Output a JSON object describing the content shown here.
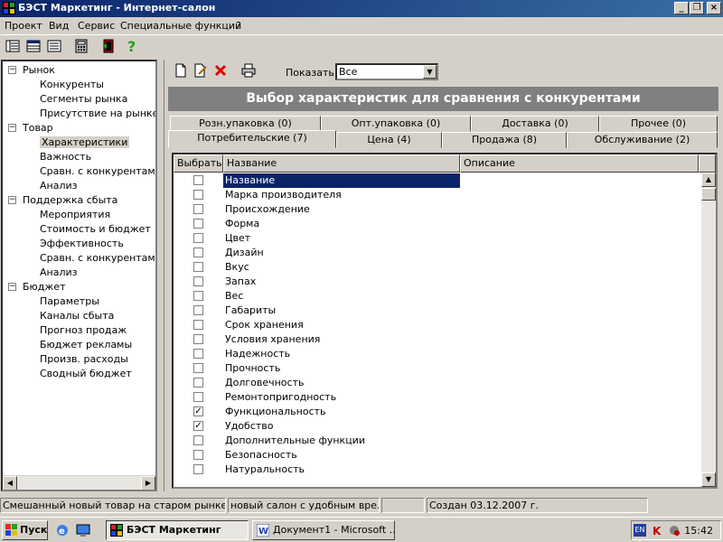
{
  "window": {
    "title": "БЭСТ Маркетинг - Интернет-салон"
  },
  "menu": [
    "Проект",
    "Вид",
    "Сервис",
    "Специальные функции",
    "?"
  ],
  "tree": [
    {
      "label": "Рынок",
      "level": 0,
      "toggle": "−"
    },
    {
      "label": "Конкуренты",
      "level": 1
    },
    {
      "label": "Сегменты рынка",
      "level": 1
    },
    {
      "label": "Присутствие на рынке",
      "level": 1
    },
    {
      "label": "Товар",
      "level": 0,
      "toggle": "−"
    },
    {
      "label": "Характеристики",
      "level": 1,
      "selected": true
    },
    {
      "label": "Важность",
      "level": 1
    },
    {
      "label": "Сравн. с конкурентами",
      "level": 1
    },
    {
      "label": "Анализ",
      "level": 1
    },
    {
      "label": "Поддержка сбыта",
      "level": 0,
      "toggle": "−"
    },
    {
      "label": "Мероприятия",
      "level": 1
    },
    {
      "label": "Стоимость и бюджет",
      "level": 1
    },
    {
      "label": "Эффективность",
      "level": 1
    },
    {
      "label": "Сравн. с конкурентами",
      "level": 1
    },
    {
      "label": "Анализ",
      "level": 1
    },
    {
      "label": "Бюджет",
      "level": 0,
      "toggle": "−"
    },
    {
      "label": "Параметры",
      "level": 1
    },
    {
      "label": "Каналы сбыта",
      "level": 1
    },
    {
      "label": "Прогноз продаж",
      "level": 1
    },
    {
      "label": "Бюджет рекламы",
      "level": 1
    },
    {
      "label": "Произв. расходы",
      "level": 1
    },
    {
      "label": "Сводный бюджет",
      "level": 1
    }
  ],
  "filter": {
    "label": "Показать",
    "value": "Все"
  },
  "banner": "Выбор характеристик для сравнения с конкурентами",
  "tabs_back": [
    "Розн.упаковка (0)",
    "Опт.упаковка (0)",
    "Доставка (0)",
    "Прочее (0)"
  ],
  "tabs_front": [
    "Потребительские (7)",
    "Цена (4)",
    "Продажа (8)",
    "Обслуживание (2)"
  ],
  "grid": {
    "headers": [
      "Выбрать",
      "Название",
      "Описание"
    ],
    "rows": [
      {
        "name": "Название",
        "checked": false,
        "selected": true
      },
      {
        "name": "Марка производителя",
        "checked": false
      },
      {
        "name": "Происхождение",
        "checked": false
      },
      {
        "name": "Форма",
        "checked": false
      },
      {
        "name": "Цвет",
        "checked": false
      },
      {
        "name": "Дизайн",
        "checked": false
      },
      {
        "name": "Вкус",
        "checked": false
      },
      {
        "name": "Запах",
        "checked": false
      },
      {
        "name": "Вес",
        "checked": false
      },
      {
        "name": "Габариты",
        "checked": false
      },
      {
        "name": "Срок хранения",
        "checked": false
      },
      {
        "name": "Условия хранения",
        "checked": false
      },
      {
        "name": "Надежность",
        "checked": false
      },
      {
        "name": "Прочность",
        "checked": false
      },
      {
        "name": "Долговечность",
        "checked": false
      },
      {
        "name": "Ремонтопригодность",
        "checked": false
      },
      {
        "name": "Функциональность",
        "checked": true
      },
      {
        "name": "Удобство",
        "checked": true
      },
      {
        "name": "Дополнительные функции",
        "checked": false
      },
      {
        "name": "Безопасность",
        "checked": false
      },
      {
        "name": "Натуральность",
        "checked": false
      }
    ]
  },
  "status": {
    "segment": "Смешанный новый товар на старом рынке",
    "salon": "новый салон с удобным вре...",
    "empty": "",
    "created": "Создан 03.12.2007 г."
  },
  "taskbar": {
    "start": "Пуск",
    "tasks": [
      "БЭСТ Маркетинг",
      "Документ1 - Microsoft ..."
    ],
    "lang": "EN",
    "clock": "15:42"
  },
  "colors": {
    "title_blue": "#0a246a",
    "selection": "#0a246a",
    "banner_gray": "#808080",
    "face": "#d4d0c8"
  }
}
